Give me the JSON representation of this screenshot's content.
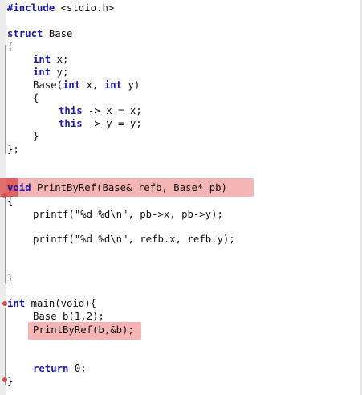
{
  "editor": {
    "language": "c",
    "lines": {
      "l01": {
        "pre": "#include",
        "rest": " <stdio.h>"
      },
      "l03": {
        "kw": "struct",
        "rest": " Base"
      },
      "l04": {
        "text": "{"
      },
      "l05": {
        "kw": "int",
        "rest": " x;"
      },
      "l06": {
        "kw": "int",
        "rest": " y;"
      },
      "l07": {
        "a": "Base(",
        "kw1": "int",
        "b": " x, ",
        "kw2": "int",
        "c": " y)"
      },
      "l08": {
        "text": "{"
      },
      "l09": {
        "kw": "this",
        "rest": " -> x = x;"
      },
      "l10": {
        "kw": "this",
        "rest": " -> y = y;"
      },
      "l11": {
        "text": "}"
      },
      "l12": {
        "text": "};"
      },
      "l15": {
        "kw": "void",
        "rest": " PrintByRef(Base& refb, Base* pb)"
      },
      "l16": {
        "text": "{"
      },
      "l17": {
        "text": "printf(\"%d %d\\n\", pb->x, pb->y);"
      },
      "l19": {
        "text": "printf(\"%d %d\\n\", refb.x, refb.y);"
      },
      "l22": {
        "text": "}"
      },
      "l24": {
        "kw": "int",
        "rest": " main(void){"
      },
      "l25": {
        "text": "Base b(1,2);"
      },
      "l26": {
        "text": "PrintByRef(b,&b);"
      },
      "l29": {
        "kw": "return",
        "rest": " 0;"
      },
      "l30": {
        "text": "}"
      }
    }
  },
  "colors": {
    "keyword": "#1a1aa6",
    "highlight": "#ee7878",
    "gutter": "#ececec",
    "fold_marker": "#d24c4c"
  }
}
